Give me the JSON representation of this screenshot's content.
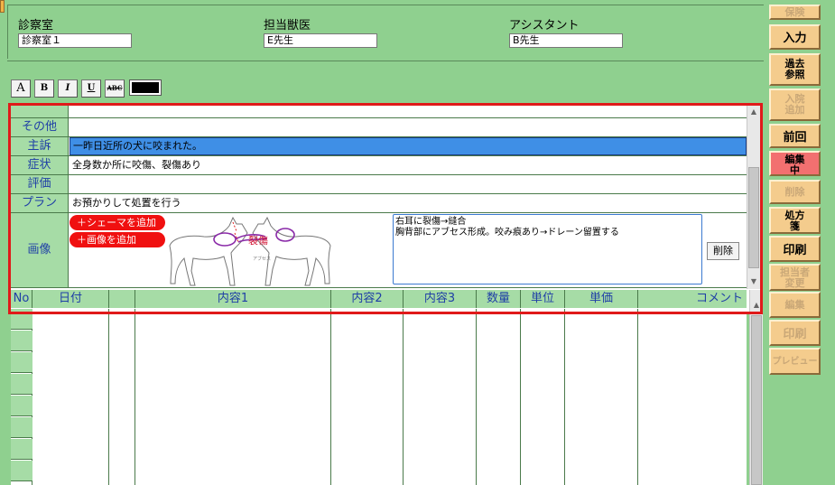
{
  "header": {
    "room_label": "診察室",
    "room_value": "診察室１",
    "doctor_label": "担当獣医",
    "doctor_value": "E先生",
    "assistant_label": "アシスタント",
    "assistant_value": "B先生"
  },
  "toolbar": {
    "font": "A",
    "bold": "B",
    "italic": "I",
    "underline": "U",
    "strike": "ABC",
    "text_color": "#000000"
  },
  "form": {
    "rows": [
      {
        "label": "その他",
        "value": ""
      },
      {
        "label": "主訴",
        "value": "一昨日近所の犬に咬まれた。"
      },
      {
        "label": "症状",
        "value": "全身数か所に咬傷、裂傷あり"
      },
      {
        "label": "評価",
        "value": ""
      },
      {
        "label": "プラン",
        "value": "お預かりして処置を行う"
      }
    ],
    "image_label": "画像",
    "add_schema": "＋シェーマを追加",
    "add_image": "＋画像を追加",
    "diagram_note1": "裂傷",
    "diagram_note2": "アブセス",
    "note_lines": [
      "右耳に裂傷→縫合",
      "胸背部にアブセス形成。咬み痕あり→ドレーン留置する"
    ],
    "delete": "削除"
  },
  "table": {
    "headers": [
      "No",
      "日付",
      "",
      "内容1",
      "内容2",
      "内容3",
      "数量",
      "単位",
      "単価",
      "コメント"
    ]
  },
  "side_buttons": [
    {
      "label": "保険",
      "enabled": false
    },
    {
      "label": "入力",
      "enabled": true
    },
    {
      "label": "過去\n参照",
      "enabled": true
    },
    {
      "label": "入院\n追加",
      "enabled": false
    },
    {
      "label": "前回",
      "enabled": true
    },
    {
      "label": "編集\n中",
      "enabled": true,
      "active": true
    },
    {
      "label": "削除",
      "enabled": false
    },
    {
      "label": "処方\n箋",
      "enabled": true
    },
    {
      "label": "印刷",
      "enabled": true
    },
    {
      "label": "担当者\n変更",
      "enabled": false
    },
    {
      "label": "編集",
      "enabled": false
    },
    {
      "label": "印刷",
      "enabled": false
    },
    {
      "label": "プレビュー",
      "enabled": false
    }
  ],
  "colors": {
    "background": "#8fd08f",
    "header_cell": "#a6dca6",
    "label_text": "#1f3fa6",
    "selection": "#3f8fe6",
    "highlight_border": "#e01a1a",
    "button": "#f4cc8d",
    "button_active": "#f27070",
    "pill": "#f01010"
  }
}
